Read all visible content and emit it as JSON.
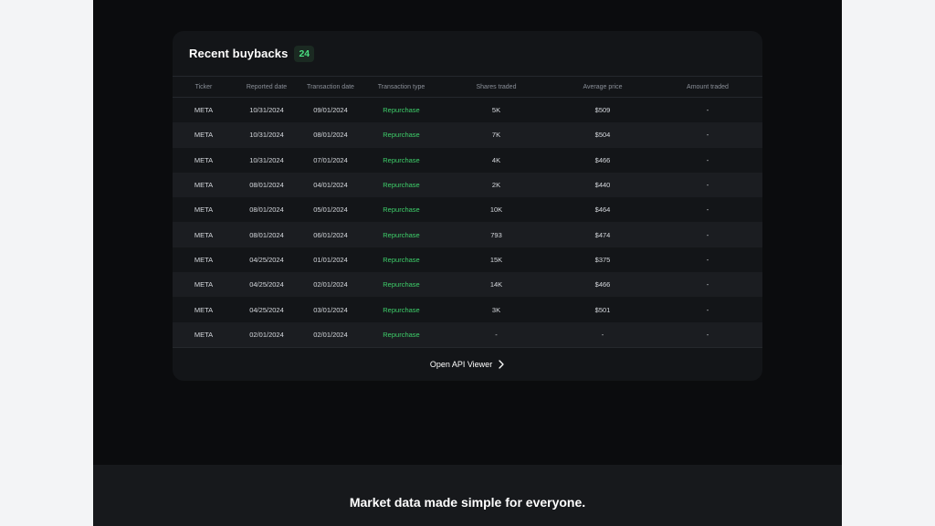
{
  "card": {
    "title": "Recent buybacks",
    "count": "24",
    "columns": [
      "Ticker",
      "Reported date",
      "Transaction date",
      "Transaction type",
      "Shares traded",
      "Average price",
      "Amount traded"
    ],
    "rows": [
      [
        "META",
        "10/31/2024",
        "09/01/2024",
        "Repurchase",
        "5K",
        "$509",
        "-"
      ],
      [
        "META",
        "10/31/2024",
        "08/01/2024",
        "Repurchase",
        "7K",
        "$504",
        "-"
      ],
      [
        "META",
        "10/31/2024",
        "07/01/2024",
        "Repurchase",
        "4K",
        "$466",
        "-"
      ],
      [
        "META",
        "08/01/2024",
        "04/01/2024",
        "Repurchase",
        "2K",
        "$440",
        "-"
      ],
      [
        "META",
        "08/01/2024",
        "05/01/2024",
        "Repurchase",
        "10K",
        "$464",
        "-"
      ],
      [
        "META",
        "08/01/2024",
        "06/01/2024",
        "Repurchase",
        "793",
        "$474",
        "-"
      ],
      [
        "META",
        "04/25/2024",
        "01/01/2024",
        "Repurchase",
        "15K",
        "$375",
        "-"
      ],
      [
        "META",
        "04/25/2024",
        "02/01/2024",
        "Repurchase",
        "14K",
        "$466",
        "-"
      ],
      [
        "META",
        "04/25/2024",
        "03/01/2024",
        "Repurchase",
        "3K",
        "$501",
        "-"
      ],
      [
        "META",
        "02/01/2024",
        "02/01/2024",
        "Repurchase",
        "-",
        "-",
        "-"
      ]
    ],
    "footer_link": "Open API Viewer",
    "footer_icon": "chevron-right-icon"
  },
  "tagline": "Market data made simple for everyone.",
  "colors": {
    "page_bg": "#0b0c0e",
    "card_bg": "#131518",
    "accent_green": "#3ecf6a"
  }
}
